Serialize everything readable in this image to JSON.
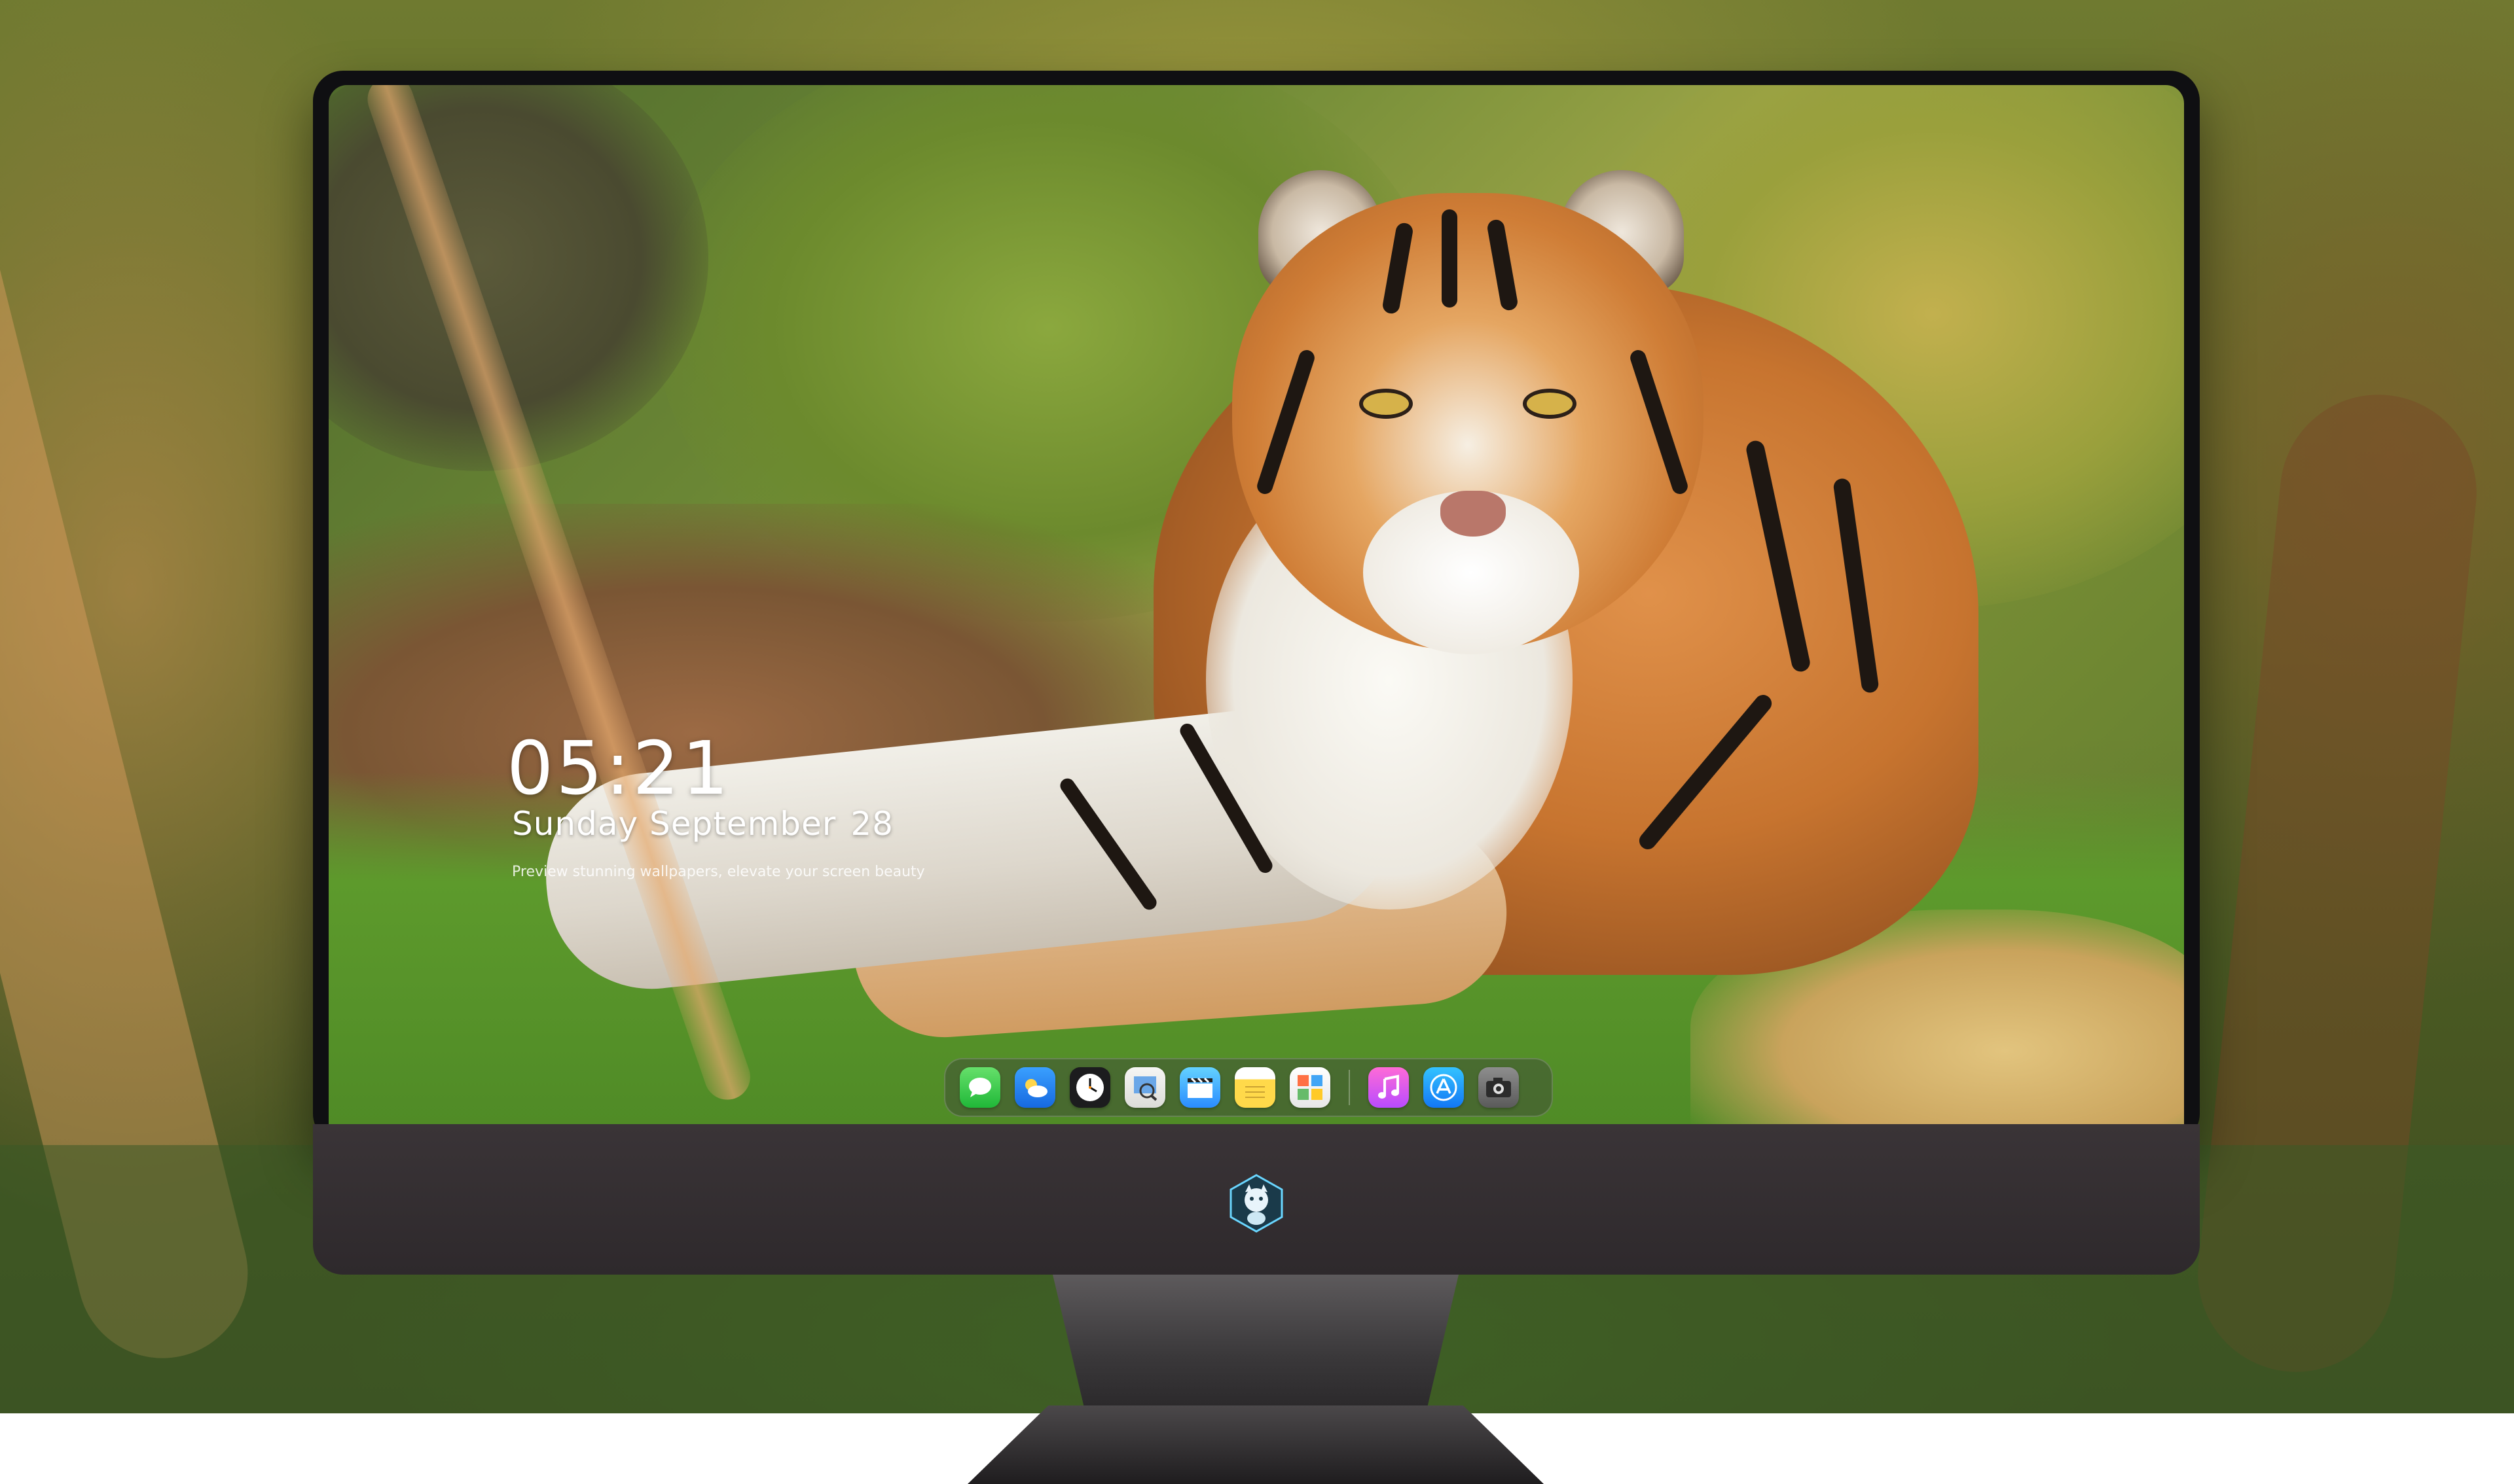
{
  "lock_screen": {
    "time": "05:21",
    "date_text": "Sunday September",
    "date_day": "28",
    "caption": "Preview stunning wallpapers, elevate your screen beauty"
  },
  "dock": {
    "apps": [
      {
        "name": "Messages",
        "icon": "messages-icon"
      },
      {
        "name": "Weather",
        "icon": "weather-icon"
      },
      {
        "name": "Clock",
        "icon": "clock-icon"
      },
      {
        "name": "Preview",
        "icon": "preview-icon"
      },
      {
        "name": "Clips",
        "icon": "clips-icon"
      },
      {
        "name": "Notes",
        "icon": "notes-icon"
      },
      {
        "name": "Photo Booth",
        "icon": "photo-booth-icon"
      },
      {
        "name": "Music",
        "icon": "music-icon"
      },
      {
        "name": "App Store",
        "icon": "app-store-icon"
      },
      {
        "name": "Camera",
        "icon": "camera-icon"
      }
    ]
  },
  "colors": {
    "bezel": "#0f0f12",
    "chin": "#3a3437",
    "dock_bg": "rgba(60,60,60,0.42)",
    "text": "#ffffff"
  }
}
